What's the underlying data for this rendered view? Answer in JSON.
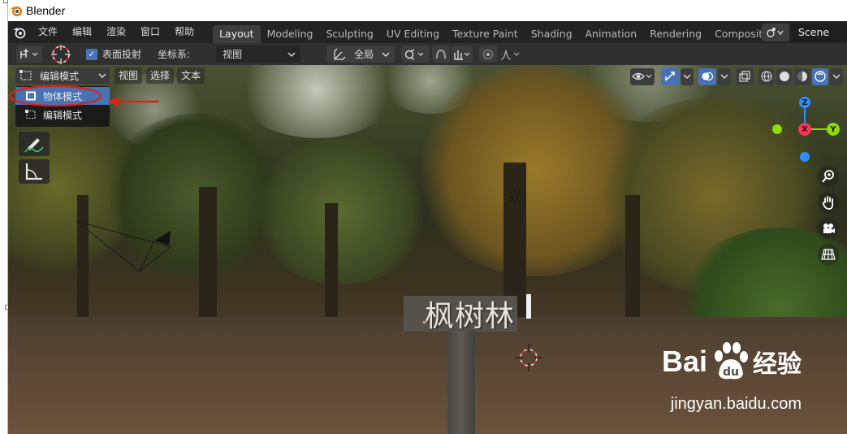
{
  "window": {
    "title": "Blender"
  },
  "menubar": {
    "items": [
      "文件",
      "编辑",
      "渲染",
      "窗口",
      "帮助"
    ]
  },
  "workspaces": {
    "tabs": [
      "Layout",
      "Modeling",
      "Sculpting",
      "UV Editing",
      "Texture Paint",
      "Shading",
      "Animation",
      "Rendering",
      "Compositing"
    ],
    "active": "Layout"
  },
  "scene": {
    "name": "Scene"
  },
  "toolbar": {
    "surface_project_label": "表面投射",
    "coord_label": "坐标系:",
    "coord_value": "视图",
    "pivot_value": "全局"
  },
  "viewport_header": {
    "mode_value": "编辑模式",
    "menus": [
      "视图",
      "选择",
      "文本"
    ]
  },
  "mode_menu": {
    "options": [
      "物体模式",
      "编辑模式"
    ],
    "highlighted": "物体模式"
  },
  "scene_content": {
    "sign_text": "枫树林"
  },
  "gizmo": {
    "x": "X",
    "y": "Y",
    "z": "Z"
  },
  "watermark": {
    "brand": "Bai",
    "brand_cn": "经验",
    "url": "jingyan.baidu.com"
  },
  "colors": {
    "accent": "#4772b3",
    "annotation": "#e0201a",
    "axis_x": "#ff3352",
    "axis_y": "#8bdc00",
    "axis_z": "#2890ff"
  }
}
